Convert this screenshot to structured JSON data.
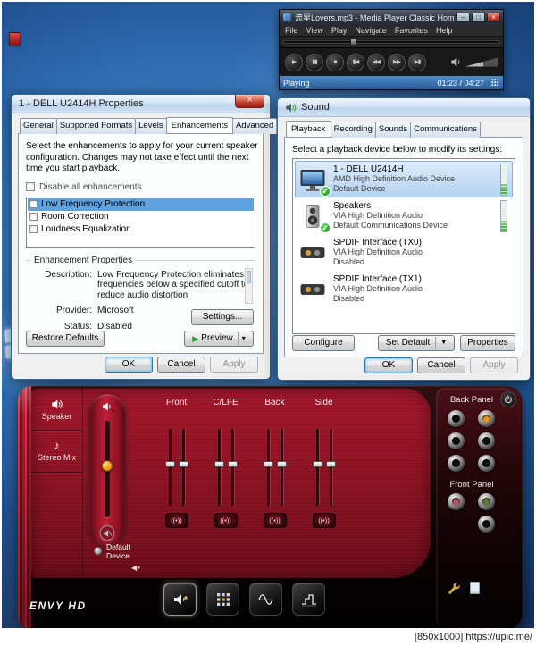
{
  "colors": {
    "aero_titlebar": "#bcd4ea",
    "selection_blue": "#5ea2e2",
    "status_bar_blue": "#3c7cc0",
    "deck_red": "#8e1022",
    "deck_accent_red": "#d81a33",
    "jack_orange": "#e89b18",
    "check_green": "#23a123"
  },
  "mpc": {
    "title": "流星Lovers.mp3 - Media Player Classic Hom...",
    "caption": {
      "minimize": "–",
      "maximize": "□",
      "close": "×"
    },
    "menu": [
      "File",
      "View",
      "Play",
      "Navigate",
      "Favorites",
      "Help"
    ],
    "controls": [
      {
        "name": "play",
        "glyph": "▶"
      },
      {
        "name": "pause",
        "glyph": "▮▮"
      },
      {
        "name": "stop",
        "glyph": "■"
      },
      {
        "name": "skip-back",
        "glyph": "▮◀"
      },
      {
        "name": "rewind",
        "glyph": "◀◀"
      },
      {
        "name": "fast-forward",
        "glyph": "▶▶"
      },
      {
        "name": "skip-forward",
        "glyph": "▶▮"
      }
    ],
    "status": "Playing",
    "time": "01:23 / 04:27"
  },
  "dell": {
    "title": "1 - DELL U2414H Properties",
    "close": "×",
    "tabs": [
      "General",
      "Supported Formats",
      "Levels",
      "Enhancements",
      "Advanced"
    ],
    "intro": "Select the enhancements to apply for your current speaker configuration. Changes may not take effect until the next time you start playback.",
    "disable_all_label": "Disable all enhancements",
    "enhancements": [
      "Low Frequency Protection",
      "Room Correction",
      "Loudness Equalization"
    ],
    "group_title": "Enhancement Properties",
    "description_label": "Description:",
    "description": "Low Frequency Protection eliminates frequencies below a specified cutoff to reduce audio distortion",
    "provider_label": "Provider:",
    "provider": "Microsoft",
    "status_label": "Status:",
    "status": "Disabled",
    "settings_button": "Settings...",
    "restore_button": "Restore Defaults",
    "preview_icon": "▶",
    "preview_button": "Preview",
    "preview_caret": "▾",
    "ok": "OK",
    "cancel": "Cancel",
    "apply": "Apply"
  },
  "sound": {
    "title": "Sound",
    "tabs": [
      "Playback",
      "Recording",
      "Sounds",
      "Communications"
    ],
    "intro": "Select a playback device below to modify its settings:",
    "check_glyph": "✓",
    "devices": [
      {
        "name": "1 - DELL U2414H",
        "detail": "AMD High Definition Audio Device",
        "state": "Default Device"
      },
      {
        "name": "Speakers",
        "detail": "VIA High Definition Audio",
        "state": "Default Communications Device"
      },
      {
        "name": "SPDIF Interface (TX0)",
        "detail": "VIA High Definition Audio",
        "state": "Disabled"
      },
      {
        "name": "SPDIF Interface (TX1)",
        "detail": "VIA High Definition Audio",
        "state": "Disabled"
      }
    ],
    "configure_button": "Configure",
    "set_default_button": "Set Default",
    "set_default_caret": "▼",
    "properties_button": "Properties",
    "ok": "OK",
    "cancel": "Cancel",
    "apply": "Apply"
  },
  "deck": {
    "sources": [
      {
        "label": "Speaker"
      },
      {
        "label": "Stereo Mix"
      }
    ],
    "note_icon": "♪",
    "default_device_label": "Default Device",
    "collapse_icon": "◀•",
    "channels": [
      "Front",
      "C/LFE",
      "Back",
      "Side"
    ],
    "test_icon": "((•))",
    "back_panel_label": "Back Panel",
    "front_panel_label": "Front Panel",
    "logo": "ENVY HD"
  },
  "watermark": "[850x1000] https://upic.me/"
}
